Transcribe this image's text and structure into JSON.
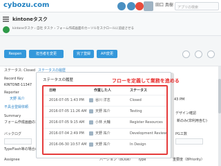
{
  "topbar": {
    "logo": "cybozu.com",
    "user_name": "田口 真樹",
    "search_placeholder": "アプリの検索"
  },
  "app": {
    "title": "kintoneタスク",
    "breadcrumb": "kintoneタスク › 自社 タスク › フォーム作成画面のカーソルをスクロールに追従させる"
  },
  "toolbar": {
    "buttons": [
      "Reopen",
      "担当者を変更",
      "完了登録",
      "API変更"
    ]
  },
  "record": {
    "status_label": "ステータス: Closed",
    "history_link": "ステータスの履歴",
    "record_key_label": "Record Key",
    "record_key_value": "KINTONE-11347",
    "reporter_label": "Reporter",
    "reporter_value": "天野 祐介",
    "related_link": "不具合登録依頼",
    "summary_label": "Summary",
    "summary_value": "フォーム作成画面のカ",
    "backlog_label": "バックログ",
    "typeflash_label": "TypeFlash等の場合のみ",
    "assignee_label": "Assignee",
    "version_label": "バージョン（8Due）",
    "type_label": "Type",
    "priority_label": "重要度（8Priority）",
    "right_time": "43 PM",
    "design_label": "デザイン確認",
    "design_value": "新のみ(非利用含む)",
    "pg_label": "PG工数"
  },
  "popup": {
    "title": "ステータスの履歴",
    "banner": "フローを定義して業務を進める",
    "columns": [
      "日時",
      "作業した人",
      "ステータス"
    ],
    "rows": [
      {
        "date": "2016-07-05 1:43 PM",
        "user": "谷川 洋志",
        "status": "Closed"
      },
      {
        "date": "2016-07-05 11:26 AM",
        "user": "天野 祐介",
        "status": "Testing"
      },
      {
        "date": "2016-07-05 9:15 AM",
        "user": "小林 大輔",
        "status": "Register Resources"
      },
      {
        "date": "2016-07-04 2:49 PM",
        "user": "天野 祐介",
        "status": "Development Review"
      },
      {
        "date": "2016-06-30 10:57 AM",
        "user": "天野 祐介",
        "status": "In Design"
      }
    ]
  },
  "colors": {
    "accent": "#3498db",
    "link": "#2f86c9",
    "highlight": "#e53b3b",
    "brand": "#1e7fc0"
  },
  "icons": [
    "menu-icon",
    "home-icon",
    "gear-icon",
    "notification-icon",
    "help-icon",
    "add-icon",
    "edit-icon",
    "options-icon",
    "app-icon"
  ]
}
